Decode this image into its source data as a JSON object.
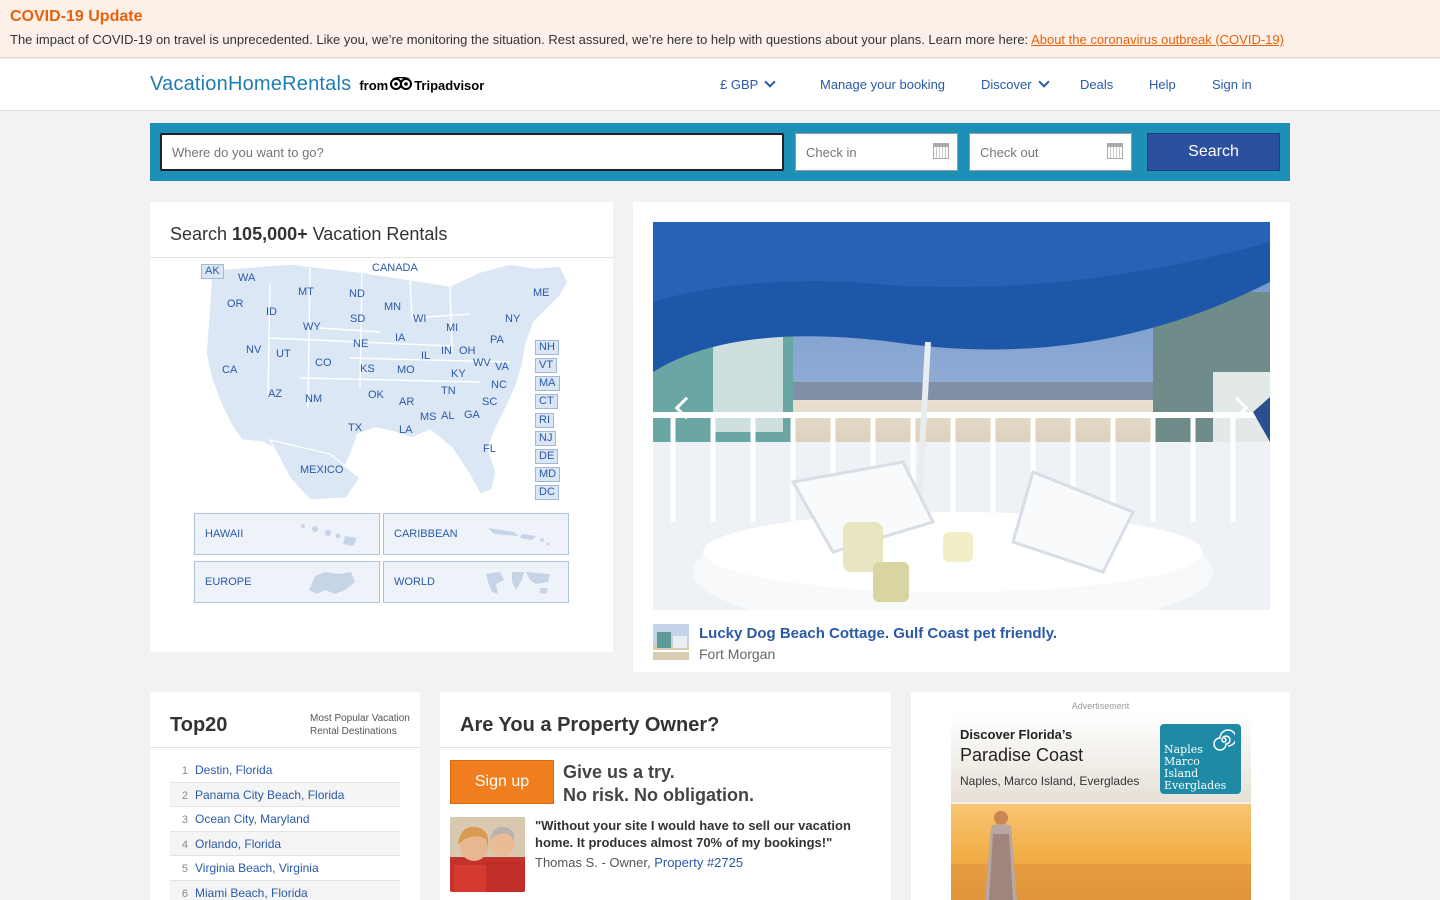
{
  "covid": {
    "title": "COVID-19 Update",
    "text": "The impact of COVID-19 on travel is unprecedented. Like you, we’re monitoring the situation. Rest assured, we’re here to help with questions about your plans. Learn more here: ",
    "link": "About the coronavirus outbreak (COVID-19)",
    "accent": "#e8620c"
  },
  "header": {
    "logo_main": "VacationHomeRentals",
    "logo_from": "from",
    "logo_brand": "Tripadvisor",
    "nav": {
      "currency": "£ GBP",
      "manage": "Manage your booking",
      "discover": "Discover",
      "deals": "Deals",
      "help": "Help",
      "signin": "Sign in"
    }
  },
  "search": {
    "where_placeholder": "Where do you want to go?",
    "checkin": "Check in",
    "checkout": "Check out",
    "button": "Search",
    "bar_color": "#1e8fb5"
  },
  "map_panel": {
    "title_prefix": "Search ",
    "title_count": "105,000+",
    "title_suffix": " Vacation Rentals",
    "labels": {
      "canada": "CANADA",
      "mexico": "MEXICO",
      "AK": "AK",
      "WA": "WA",
      "OR": "OR",
      "ID": "ID",
      "MT": "MT",
      "WY": "WY",
      "ND": "ND",
      "SD": "SD",
      "NE": "NE",
      "MN": "MN",
      "WI": "WI",
      "MI": "MI",
      "IA": "IA",
      "IL": "IL",
      "IN": "IN",
      "OH": "OH",
      "PA": "PA",
      "NY": "NY",
      "ME": "ME",
      "NV": "NV",
      "UT": "UT",
      "CO": "CO",
      "KS": "KS",
      "MO": "MO",
      "KY": "KY",
      "WV": "WV",
      "VA": "VA",
      "CA": "CA",
      "AZ": "AZ",
      "NM": "NM",
      "OK": "OK",
      "AR": "AR",
      "TN": "TN",
      "NC": "NC",
      "SC": "SC",
      "TX": "TX",
      "LA": "LA",
      "MS": "MS",
      "AL": "AL",
      "GA": "GA",
      "FL": "FL",
      "NH": "NH",
      "VT": "VT",
      "MA": "MA",
      "CT": "CT",
      "RI": "RI",
      "NJ": "NJ",
      "DE": "DE",
      "MD": "MD",
      "DC": "DC"
    },
    "regions": {
      "hawaii": "HAWAII",
      "caribbean": "CARIBBEAN",
      "europe": "EUROPE",
      "world": "WORLD"
    }
  },
  "feature": {
    "title": "Lucky Dog Beach Cottage. Gulf Coast pet friendly.",
    "location": "Fort Morgan"
  },
  "top20": {
    "title": "Top20",
    "subtitle_1": "Most Popular Vacation",
    "subtitle_2": "Rental Destinations",
    "items": [
      {
        "num": "1",
        "name": "Destin, Florida"
      },
      {
        "num": "2",
        "name": "Panama City Beach, Florida"
      },
      {
        "num": "3",
        "name": "Ocean City, Maryland"
      },
      {
        "num": "4",
        "name": "Orlando, Florida"
      },
      {
        "num": "5",
        "name": "Virginia Beach, Virginia"
      },
      {
        "num": "6",
        "name": "Miami Beach, Florida"
      }
    ]
  },
  "owner": {
    "title": "Are You a Property Owner?",
    "signup": "Sign up",
    "try_1": "Give us a try.",
    "try_2": "No risk. No obligation.",
    "quote": "\"Without your site I would have to sell our vacation home. It produces almost 70% of my bookings!\"",
    "quote_by": "Thomas S. - Owner, ",
    "property_link": "Property #2725",
    "signup_color": "#f07d1e"
  },
  "ad": {
    "label": "Advertisement",
    "line1": "Discover Florida’s",
    "line2": "Paradise Coast",
    "line3": "Naples, Marco Island, Everglades",
    "logo_line1": "Naples",
    "logo_line2": "Marco Island",
    "logo_line3": "Everglades"
  }
}
